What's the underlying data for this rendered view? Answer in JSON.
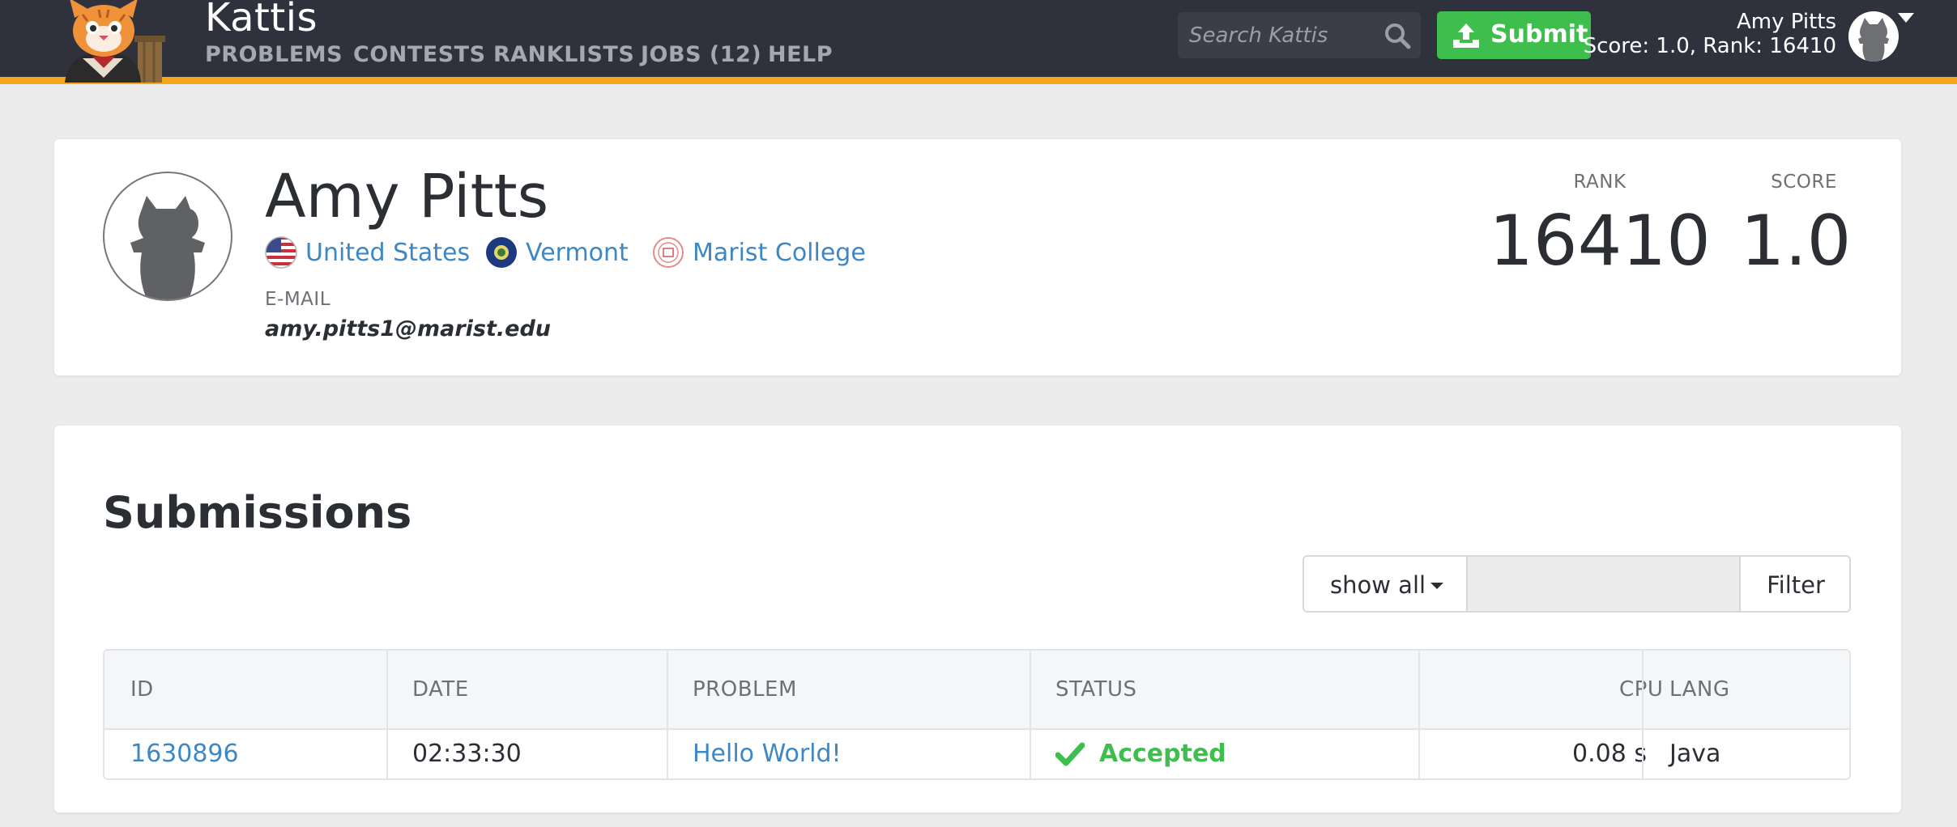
{
  "brand": "Kattis",
  "nav": {
    "problems": "PROBLEMS",
    "contests": "CONTESTS",
    "ranklists": "RANKLISTS",
    "jobs": "JOBS (12)",
    "help": "HELP"
  },
  "search": {
    "placeholder": "Search Kattis",
    "icon": "search-icon"
  },
  "submit": {
    "label": "Submit",
    "icon": "upload-icon"
  },
  "user": {
    "name": "Amy Pitts",
    "meta": "Score: 1.0, Rank: 16410"
  },
  "colors": {
    "topbar": "#2f323c",
    "accent_stripe": "#f2a61c",
    "submit_green": "#3ebe4c",
    "link_blue": "#3d87c4",
    "accepted_green": "#3ebe4c"
  },
  "profile": {
    "name": "Amy Pitts",
    "country": "United States",
    "region": "Vermont",
    "school": "Marist College",
    "email_label": "E-MAIL",
    "email": "amy.pitts1@marist.edu",
    "rank_label": "RANK",
    "rank": "16410",
    "score_label": "SCORE",
    "score": "1.0"
  },
  "submissions": {
    "title": "Submissions",
    "filter_select": "show all",
    "filter_input_value": "",
    "filter_button": "Filter",
    "columns": {
      "id": "ID",
      "date": "DATE",
      "problem": "PROBLEM",
      "status": "STATUS",
      "cpu": "CPU",
      "lang": "LANG"
    },
    "rows": [
      {
        "id": "1630896",
        "date": "02:33:30",
        "problem": "Hello World!",
        "status": "Accepted",
        "cpu": "0.08 s",
        "lang": "Java"
      }
    ]
  }
}
